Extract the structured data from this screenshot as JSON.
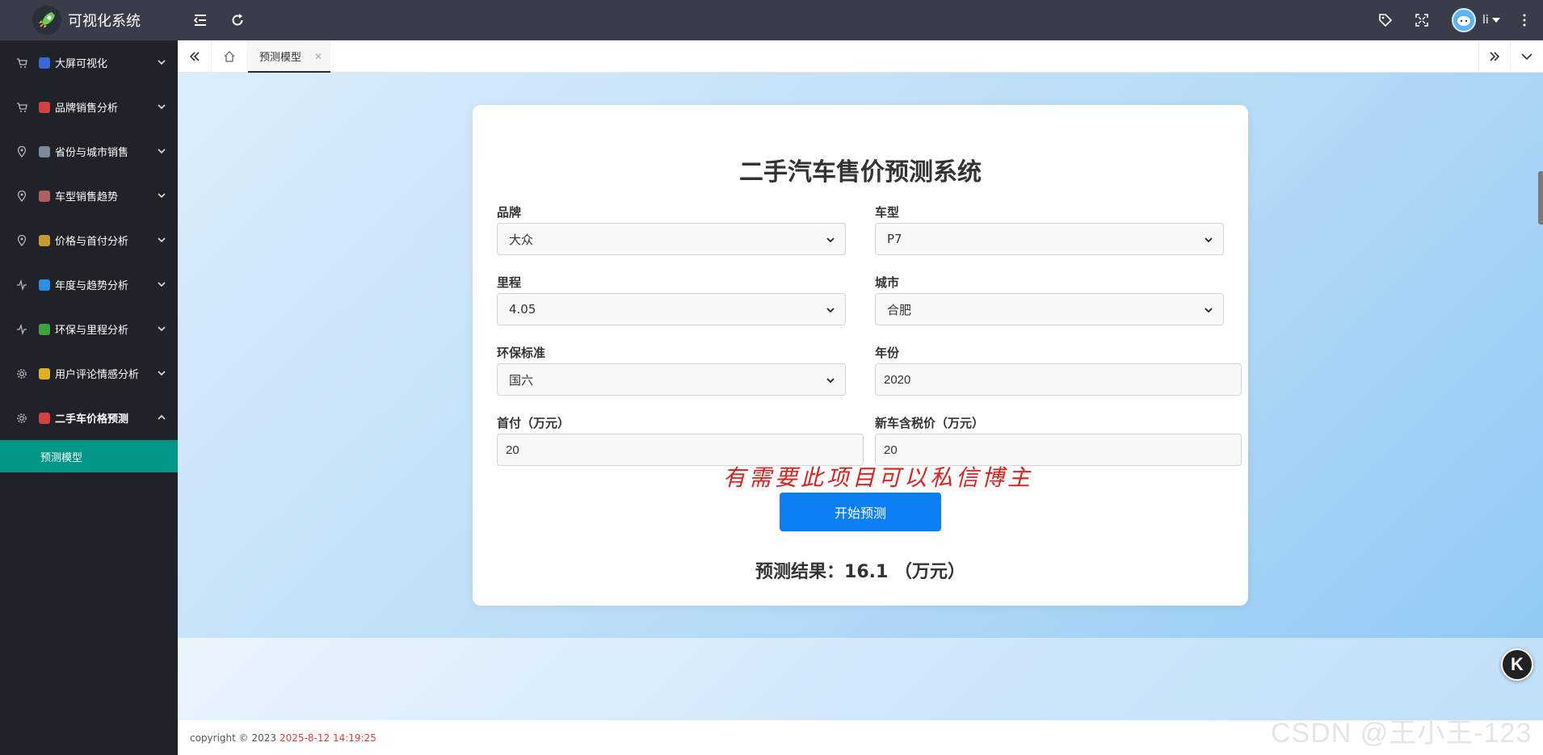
{
  "app": {
    "title": "可视化系统"
  },
  "user": {
    "name": "li"
  },
  "sidebar": {
    "items": [
      {
        "label": "大屏可视化",
        "lead_icon": "cart-icon",
        "emoji_color": "#3a66d6"
      },
      {
        "label": "品牌销售分析",
        "lead_icon": "cart-icon",
        "emoji_color": "#d64040"
      },
      {
        "label": "省份与城市销售",
        "lead_icon": "location-icon",
        "emoji_color": "#7a8a9a"
      },
      {
        "label": "车型销售趋势",
        "lead_icon": "location-icon",
        "emoji_color": "#b06060"
      },
      {
        "label": "价格与首付分析",
        "lead_icon": "location-icon",
        "emoji_color": "#c79a2b"
      },
      {
        "label": "年度与趋势分析",
        "lead_icon": "pulse-icon",
        "emoji_color": "#2a8fe0"
      },
      {
        "label": "环保与里程分析",
        "lead_icon": "pulse-icon",
        "emoji_color": "#3da33d"
      },
      {
        "label": "用户评论情感分析",
        "lead_icon": "gear-icon",
        "emoji_color": "#e0b020"
      },
      {
        "label": "二手车价格预测",
        "lead_icon": "gear-icon",
        "emoji_color": "#d64040"
      }
    ],
    "active_sub": "预测模型"
  },
  "tabs": {
    "active_label": "预测模型"
  },
  "form": {
    "title": "二手汽车售价预测系统",
    "brand_label": "品牌",
    "brand_value": "大众",
    "model_label": "车型",
    "model_value": "P7",
    "mileage_label": "里程",
    "mileage_value": "4.05",
    "city_label": "城市",
    "city_value": "合肥",
    "emission_label": "环保标准",
    "emission_value": "国六",
    "year_label": "年份",
    "year_value": "2020",
    "down_label": "首付（万元）",
    "down_value": "20",
    "newprice_label": "新车含税价（万元）",
    "newprice_value": "20",
    "submit_label": "开始预测",
    "result_text": "预测结果：16.1 （万元）",
    "overlay_text": "有需要此项目可以私信博主"
  },
  "footer": {
    "copyright": "copyright © 2023",
    "datetime": "2025-8-12 14:19:25"
  },
  "watermark": {
    "text": "CSDN @王小王-123"
  },
  "floating": {
    "k_label": "K"
  },
  "colors": {
    "accent": "#009688",
    "primary_button": "#0d7ff5",
    "sidebar_bg": "#20222a",
    "topbar_bg": "#393d49"
  }
}
